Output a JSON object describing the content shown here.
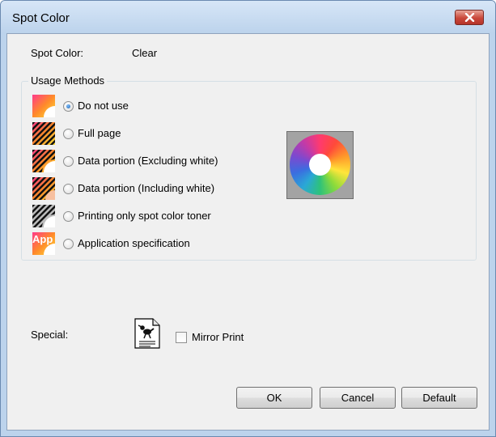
{
  "window": {
    "title": "Spot Color"
  },
  "spot_color": {
    "label": "Spot Color:",
    "value": "Clear"
  },
  "usage_methods": {
    "title": "Usage Methods",
    "options": [
      {
        "label": "Do not use",
        "selected": true,
        "icon": "gradient-arc-icon"
      },
      {
        "label": "Full page",
        "selected": false,
        "icon": "hatched-page-icon"
      },
      {
        "label": "Data portion (Excluding white)",
        "selected": false,
        "icon": "hatched-arc-icon"
      },
      {
        "label": "Data portion (Including white)",
        "selected": false,
        "icon": "hatched-arc-icon"
      },
      {
        "label": "Printing only spot color toner",
        "selected": false,
        "icon": "gray-hatched-arc-icon"
      },
      {
        "label": "Application specification",
        "selected": false,
        "icon": "app-icon",
        "icon_text": "App"
      }
    ]
  },
  "special": {
    "label": "Special:",
    "mirror_print_label": "Mirror Print",
    "mirror_print_checked": false
  },
  "buttons": {
    "ok": "OK",
    "cancel": "Cancel",
    "default": "Default"
  },
  "colors": {
    "titlebar": "#bcd3ec",
    "dialog_bg": "#f0f0f0",
    "close_button": "#c9473a",
    "radio_dot": "#1f5fa8"
  }
}
